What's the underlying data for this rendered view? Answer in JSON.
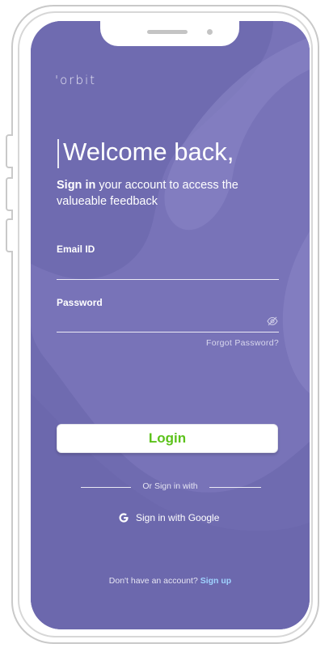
{
  "app": {
    "logo": "'orbit"
  },
  "welcome": {
    "heading": "Welcome back,",
    "subtitle_bold": "Sign in",
    "subtitle_rest": " your account to access the valueable feedback"
  },
  "form": {
    "email_label": "Email ID",
    "email_value": "",
    "password_label": "Password",
    "password_value": "",
    "forgot_link": "Forgot Password?"
  },
  "actions": {
    "login_label": "Login",
    "divider_text": "Or Sign in with",
    "google_label": "Sign in with Google"
  },
  "footer": {
    "prompt": "Don't have an account? ",
    "signup_link": "Sign up"
  },
  "icons": {
    "password_toggle": "eye-slash-icon",
    "google": "google-g-icon"
  },
  "colors": {
    "screen_bg": "#6f6bb0",
    "login_text": "#5cc21b",
    "signup_link": "#9fd3ff"
  }
}
